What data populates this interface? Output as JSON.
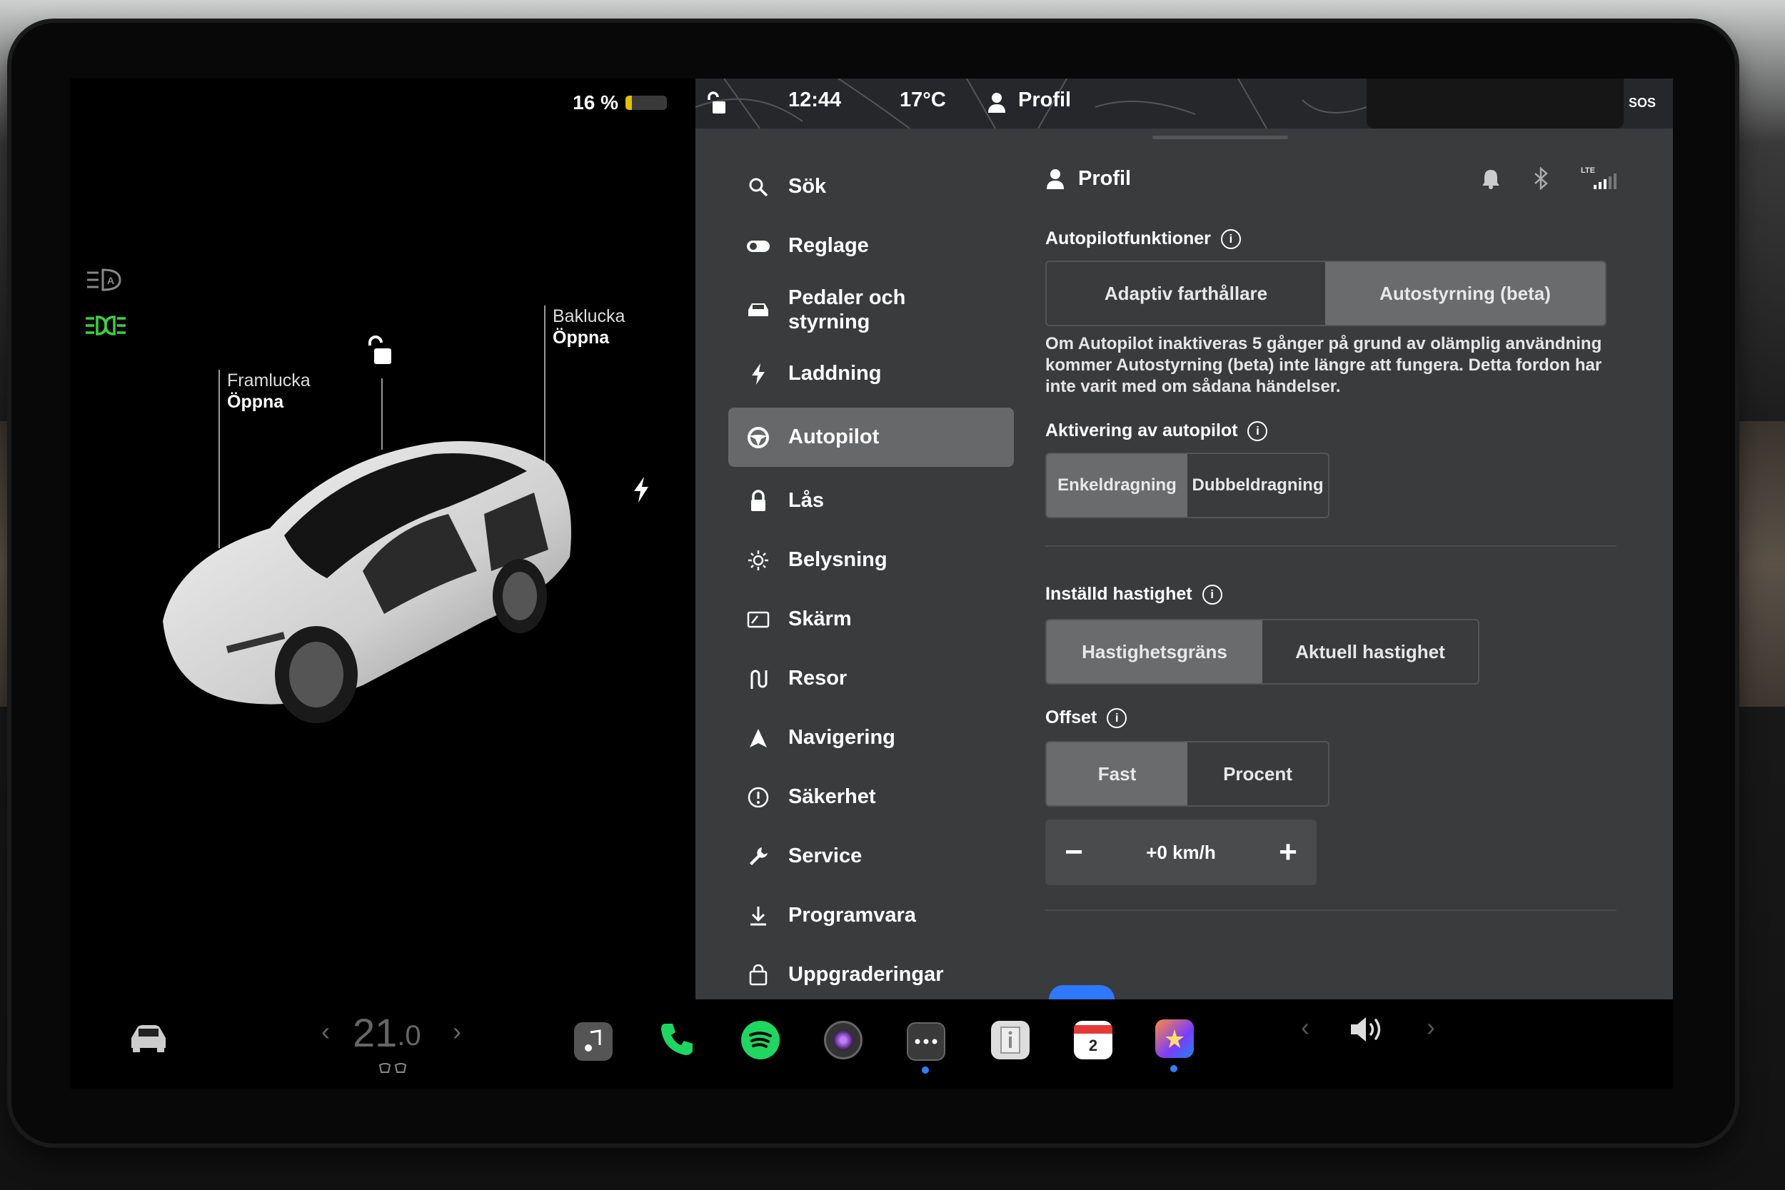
{
  "status": {
    "battery_percent": "16 %",
    "battery_level": 0.16,
    "time": "12:44",
    "temperature": "17°C",
    "profile_label": "Profil",
    "sos": "SOS",
    "lte": "LTE"
  },
  "car_view": {
    "front_trunk": {
      "name": "Framlucka",
      "action": "Öppna"
    },
    "rear_trunk": {
      "name": "Baklucka",
      "action": "Öppna"
    }
  },
  "menu": {
    "items": [
      {
        "label": "Sök",
        "icon": "search-icon"
      },
      {
        "label": "Reglage",
        "icon": "toggle-icon"
      },
      {
        "label": "Pedaler och styrning",
        "icon": "car-icon"
      },
      {
        "label": "Laddning",
        "icon": "bolt-icon"
      },
      {
        "label": "Autopilot",
        "icon": "steering-wheel-icon",
        "active": true
      },
      {
        "label": "Lås",
        "icon": "lock-icon"
      },
      {
        "label": "Belysning",
        "icon": "sun-icon"
      },
      {
        "label": "Skärm",
        "icon": "display-icon"
      },
      {
        "label": "Resor",
        "icon": "trips-icon"
      },
      {
        "label": "Navigering",
        "icon": "navigation-icon"
      },
      {
        "label": "Säkerhet",
        "icon": "alert-icon"
      },
      {
        "label": "Service",
        "icon": "wrench-icon"
      },
      {
        "label": "Programvara",
        "icon": "download-icon"
      },
      {
        "label": "Uppgraderingar",
        "icon": "bag-icon"
      }
    ]
  },
  "content": {
    "header_title": "Profil",
    "autopilot_features": {
      "title": "Autopilotfunktioner",
      "options": [
        "Adaptiv farthållare",
        "Autostyrning (beta)"
      ],
      "selected": "Autostyrning (beta)",
      "description": "Om Autopilot inaktiveras 5 gånger på grund av olämplig användning kommer Autostyrning (beta) inte längre att fungera. Detta fordon har inte varit med om sådana händelser."
    },
    "activation": {
      "title": "Aktivering av autopilot",
      "options": [
        "Enkeldragning",
        "Dubbeldragning"
      ],
      "selected": "Enkeldragning"
    },
    "set_speed": {
      "title": "Inställd hastighet",
      "options": [
        "Hastighetsgräns",
        "Aktuell hastighet"
      ],
      "selected": "Hastighetsgräns"
    },
    "offset": {
      "title": "Offset",
      "options": [
        "Fast",
        "Procent"
      ],
      "selected": "Fast",
      "value": "+0 km/h",
      "minus": "−",
      "plus": "+"
    }
  },
  "dock": {
    "temperature_whole": "21",
    "temperature_decimal": ".0",
    "apps": [
      "music-icon",
      "phone-icon",
      "spotify-icon",
      "camera-icon",
      "more-icon",
      "manual-icon",
      "calendar-icon",
      "toybox-icon"
    ],
    "calendar_day": "2",
    "chevron_left": "‹",
    "chevron_right": "›"
  },
  "colors": {
    "accent_green": "#1ed760",
    "active_blue": "#2f7fff",
    "battery_yellow": "#e0c200",
    "headlight_green": "#3bd23b"
  }
}
